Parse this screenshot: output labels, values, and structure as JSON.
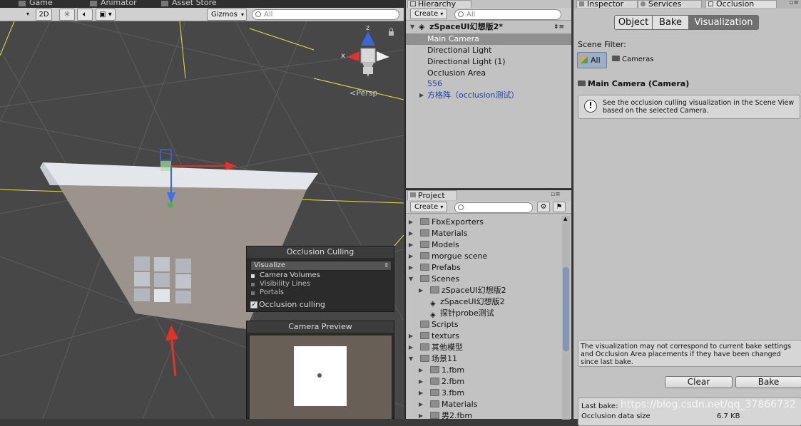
{
  "scene": {
    "tabs": [
      "Game",
      "Animator",
      "Asset Store"
    ],
    "toolbar": {
      "mode_2d": "2D",
      "gizmos": "Gizmos",
      "search_placeholder": "All"
    },
    "persp_label": "Persp",
    "axis_x": "x",
    "axis_z": "z",
    "occlusion_overlay": {
      "title": "Occlusion Culling",
      "select_value": "Visualize",
      "items": [
        "Camera Volumes",
        "Visibility Lines",
        "Portals"
      ],
      "checkbox_label": "Occlusion culling",
      "checkbox_checked": true
    },
    "camera_preview": {
      "title": "Camera Preview"
    }
  },
  "hierarchy": {
    "tab": "Hierarchy",
    "create": "Create",
    "search_placeholder": "All",
    "scene_name": "zSpaceUI幻想版2*",
    "items": [
      {
        "label": "Main Camera",
        "selected": true,
        "color": "#ffffff"
      },
      {
        "label": "Directional Light",
        "selected": false,
        "color": "#111111"
      },
      {
        "label": "Directional Light (1)",
        "selected": false,
        "color": "#111111"
      },
      {
        "label": "Occlusion Area",
        "selected": false,
        "color": "#111111"
      },
      {
        "label": "556",
        "selected": false,
        "color": "#1b3fa0"
      },
      {
        "label": "方格阵（occlusion测试）",
        "selected": false,
        "color": "#1b3fa0"
      }
    ]
  },
  "project": {
    "tab": "Project",
    "create": "Create",
    "items": [
      {
        "label": "FbxExporters",
        "type": "folder"
      },
      {
        "label": "Materials",
        "type": "folder"
      },
      {
        "label": "Models",
        "type": "folder"
      },
      {
        "label": "morgue scene",
        "type": "folder"
      },
      {
        "label": "Prefabs",
        "type": "folder"
      },
      {
        "label": "Scenes",
        "type": "folder"
      },
      {
        "label": "zSpaceUI幻想版2",
        "type": "folder"
      },
      {
        "label": "zSpaceUI幻想版2",
        "type": "scene"
      },
      {
        "label": "探针probe测试",
        "type": "scene"
      },
      {
        "label": "Scripts",
        "type": "folder"
      },
      {
        "label": "texturs",
        "type": "folder"
      },
      {
        "label": "其他模型",
        "type": "folder"
      },
      {
        "label": "场景11",
        "type": "folder"
      },
      {
        "label": "1.fbm",
        "type": "folder"
      },
      {
        "label": "2.fbm",
        "type": "folder"
      },
      {
        "label": "3.fbm",
        "type": "folder"
      },
      {
        "label": "Materials",
        "type": "folder"
      },
      {
        "label": "男2.fbm",
        "type": "folder"
      }
    ]
  },
  "inspector": {
    "tabs": [
      "Inspector",
      "Services",
      "Occlusion"
    ],
    "segments": [
      "Object",
      "Bake",
      "Visualization"
    ],
    "active_segment": "Visualization",
    "scene_filter_label": "Scene Filter:",
    "filter_all": "All",
    "filter_cameras": "Cameras",
    "camera_heading": "Main Camera (Camera)",
    "info_text": "See the occlusion culling visualization in the Scene View based on the selected Camera.",
    "warning_text": "The visualization may not correspond to current bake settings and Occlusion Area placements if they have been changed since last bake.",
    "clear_button": "Clear",
    "bake_button": "Bake",
    "last_bake_label": "Last bake:",
    "occlusion_data_size_label": "Occlusion data size",
    "occlusion_data_size_value": "6.7 KB"
  },
  "watermark": "https://blog.csdn.net/qq_37866732"
}
